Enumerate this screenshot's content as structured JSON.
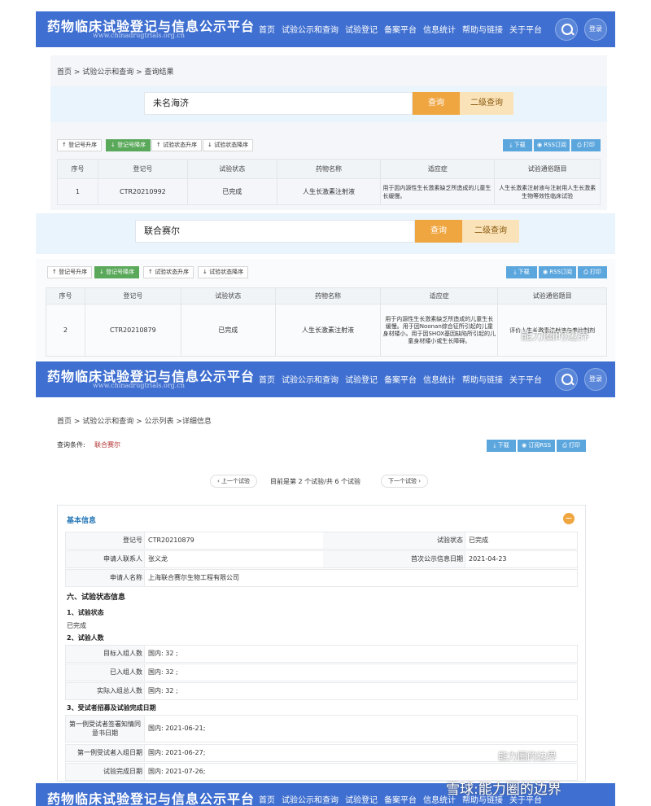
{
  "site": {
    "title": "药物临床试验登记与信息公示平台",
    "subtitle": "www.chinadrugtrials.org.cn",
    "nav": [
      "首页",
      "试验公示和查询",
      "试验登记",
      "备案平台",
      "信息统计",
      "帮助与链接",
      "关于平台"
    ],
    "login": "登录"
  },
  "panel1": {
    "breadcrumb": "首页 > 试验公示和查询 > 查询结果",
    "search_value": "未名海济",
    "query_btn": "查询",
    "query2_btn": "二级查询",
    "sort_buttons": [
      "登记号升序",
      "登记号降序",
      "试验状态升序",
      "试验状态降序"
    ],
    "tools": [
      "下载",
      "RSS订阅",
      "打印"
    ],
    "columns": [
      "序号",
      "登记号",
      "试验状态",
      "药物名称",
      "适应症",
      "试验通俗题目"
    ],
    "rows": [
      [
        "1",
        "CTR20210992",
        "已完成",
        "人生长激素注射液",
        "用于因内源性生长激素缺乏所造成的儿童生长缓慢。",
        "人生长激素注射液与注射用人生长激素生物等效性临床试验"
      ]
    ]
  },
  "panel2": {
    "search_value": "联合赛尔",
    "query_btn": "查询",
    "query2_btn": "二级查询",
    "sort_buttons": [
      "登记号升序",
      "登记号降序",
      "试验状态升序",
      "试验状态降序"
    ],
    "tools": [
      "下载",
      "RSS订阅",
      "打印"
    ],
    "columns": [
      "序号",
      "登记号",
      "试验状态",
      "药物名称",
      "适应症",
      "试验通俗题目"
    ],
    "rows": [
      [
        "2",
        "CTR20210879",
        "已完成",
        "人生长激素注射液",
        "用于内源性生长激素缺乏所造成的儿童生长缓慢。用于因Noonan综合征所引起的儿童身材矮小。用于因SHOX基因缺陷所引起的儿童身材矮小或生长障碍。",
        "评价人生长激素注射液与参比制剂"
      ]
    ]
  },
  "detail": {
    "breadcrumb": "首页 > 试验公示和查询 > 公示列表 >详细信息",
    "query_label": "查询条件:",
    "query_value": "联合赛尔",
    "tools": [
      "下载",
      "订阅RSS",
      "打印"
    ],
    "prev": "上一个试验",
    "position": "目前是第 2 个试验/共 6 个试验",
    "next": "下一个试验",
    "basic_title": "基本信息",
    "reg_no_label": "登记号",
    "reg_no": "CTR20210879",
    "status_label": "试验状态",
    "status": "已完成",
    "contact_label": "申请人联系人",
    "contact": "张义龙",
    "first_pub_label": "首次公示信息日期",
    "first_pub": "2021-04-23",
    "applicant_label": "申请人名称",
    "applicant": "上海联合赛尔生物工程有限公司",
    "sec6": "六、试验状态信息",
    "sub1": "1、试验状态",
    "sub1_val": "已完成",
    "sub2": "2、试验人数",
    "target_label": "目标入组人数",
    "target": "国内: 32 ;",
    "enrolled_label": "已入组人数",
    "enrolled": "国内: 32 ;",
    "actual_label": "实际入组总人数",
    "actual": "国内: 32 ;",
    "sub3": "3、受试者招募及试验完成日期",
    "first_consent_label": "第一例受试者签署知情同意书日期",
    "first_consent": "国内: 2021-06-21;",
    "first_enroll_label": "第一例受试者入组日期",
    "first_enroll": "国内: 2021-06-27;",
    "complete_label": "试验完成日期",
    "complete": "国内: 2021-07-26;"
  },
  "watermarks": {
    "wm1": "能力圈的边界",
    "wm2": "能力圈的边界",
    "wm3": "雪球:能力圈的边界"
  }
}
